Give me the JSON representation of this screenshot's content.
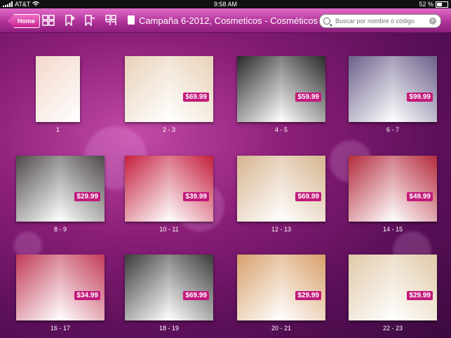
{
  "status_bar": {
    "carrier": "AT&T",
    "time": "9:58 AM",
    "battery": "52 %",
    "battery_level": 0.52
  },
  "nav": {
    "home_label": "Home",
    "title": "Campaña 6-2012, Cosmeticos - Cosméticos",
    "search_placeholder": "Buscar por nombre o código",
    "clear_icon": "×"
  },
  "thumbnails": [
    {
      "label": "1",
      "price": "",
      "accent": "#f2d7c9"
    },
    {
      "label": "2 - 3",
      "price": "$69.99",
      "accent": "#e8d2b7"
    },
    {
      "label": "4 - 5",
      "price": "$59.99",
      "accent": "#2b2b2b"
    },
    {
      "label": "6 - 7",
      "price": "$99.99",
      "accent": "#6b5f8a"
    },
    {
      "label": "8 - 9",
      "price": "$29.99",
      "accent": "#4f4a4a"
    },
    {
      "label": "10 - 11",
      "price": "$39.99",
      "accent": "#c41f3d"
    },
    {
      "label": "12 - 13",
      "price": "$69.99",
      "accent": "#d6b48f"
    },
    {
      "label": "14 - 15",
      "price": "$49.99",
      "accent": "#b42a3b"
    },
    {
      "label": "16 - 17",
      "price": "$34.99",
      "accent": "#c23b57"
    },
    {
      "label": "18 - 19",
      "price": "$69.99",
      "accent": "#3c3c3c"
    },
    {
      "label": "20 - 21",
      "price": "$29.99",
      "accent": "#d7a06b"
    },
    {
      "label": "22 - 23",
      "price": "$29.99",
      "accent": "#e0c9a8"
    }
  ]
}
